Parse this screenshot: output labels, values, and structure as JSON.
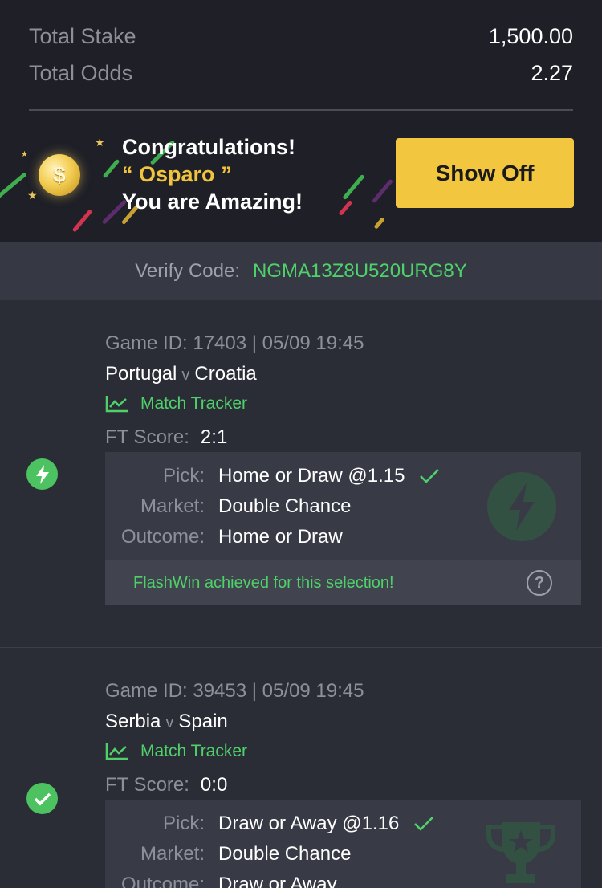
{
  "summary": {
    "total_stake_label": "Total Stake",
    "total_stake_value": "1,500.00",
    "total_odds_label": "Total Odds",
    "total_odds_value": "2.27"
  },
  "banner": {
    "line1": "Congratulations!",
    "quote_open": "“",
    "username": "Osparo",
    "quote_close": "”",
    "line3": "You are Amazing!",
    "button_label": "Show Off",
    "coin_icon": "gold-coin-icon",
    "accent": "#f2c63e"
  },
  "verify": {
    "label": "Verify Code:",
    "code": "NGMA13Z8U520URG8Y"
  },
  "selections": [
    {
      "status_icon": "flash-bolt-icon",
      "game_id": "Game ID: 17403 | 05/09 19:45",
      "home": "Portugal",
      "vs": "v",
      "away": "Croatia",
      "tracker": "Match Tracker",
      "ft_label": "FT Score:",
      "ft_value": "2:1",
      "pick_label": "Pick:",
      "pick_value": "Home or Draw @1.15",
      "market_label": "Market:",
      "market_value": "Double Chance",
      "outcome_label": "Outcome:",
      "outcome_value": "Home or Draw",
      "flash_message": "FlashWin achieved for this selection!",
      "help_icon": "question-mark-icon"
    },
    {
      "status_icon": "check-circle-icon",
      "game_id": "Game ID: 39453 | 05/09 19:45",
      "home": "Serbia",
      "vs": "v",
      "away": "Spain",
      "tracker": "Match Tracker",
      "ft_label": "FT Score:",
      "ft_value": "0:0",
      "pick_label": "Pick:",
      "pick_value": "Draw or Away @1.16",
      "market_label": "Market:",
      "market_value": "Double Chance",
      "outcome_label": "Outcome:",
      "outcome_value": "Draw or Away"
    }
  ],
  "colors": {
    "green": "#4fd16a",
    "status_green": "#4cc261",
    "yellow": "#f2c63e",
    "background": "#2b2d36"
  }
}
